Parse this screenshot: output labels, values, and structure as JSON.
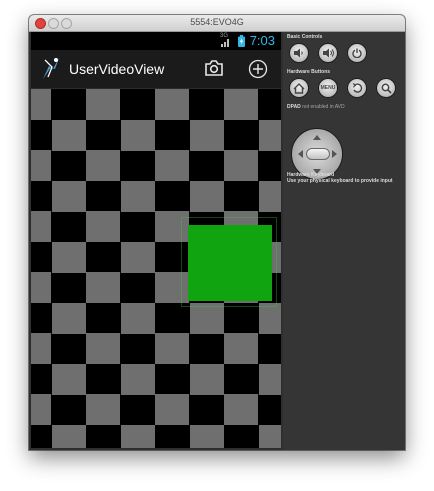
{
  "window": {
    "title": "5554:EVO4G"
  },
  "status_bar": {
    "network": "3G",
    "time": "7:03"
  },
  "action_bar": {
    "app_title": "UserVideoView"
  },
  "controls": {
    "basic_controls": "Basic Controls",
    "hardware_buttons": "Hardware Buttons",
    "dpad": "DPAD",
    "dpad_note": "not enabled in AVD",
    "hw_keyboard": "Hardware Keyboard",
    "hw_keyboard_note": "Use your physical keyboard to provide input",
    "menu_label": "MENU"
  },
  "colors": {
    "accent": "#33b5e5",
    "green_box": "#10a510",
    "checker": "#6f6f6f"
  }
}
